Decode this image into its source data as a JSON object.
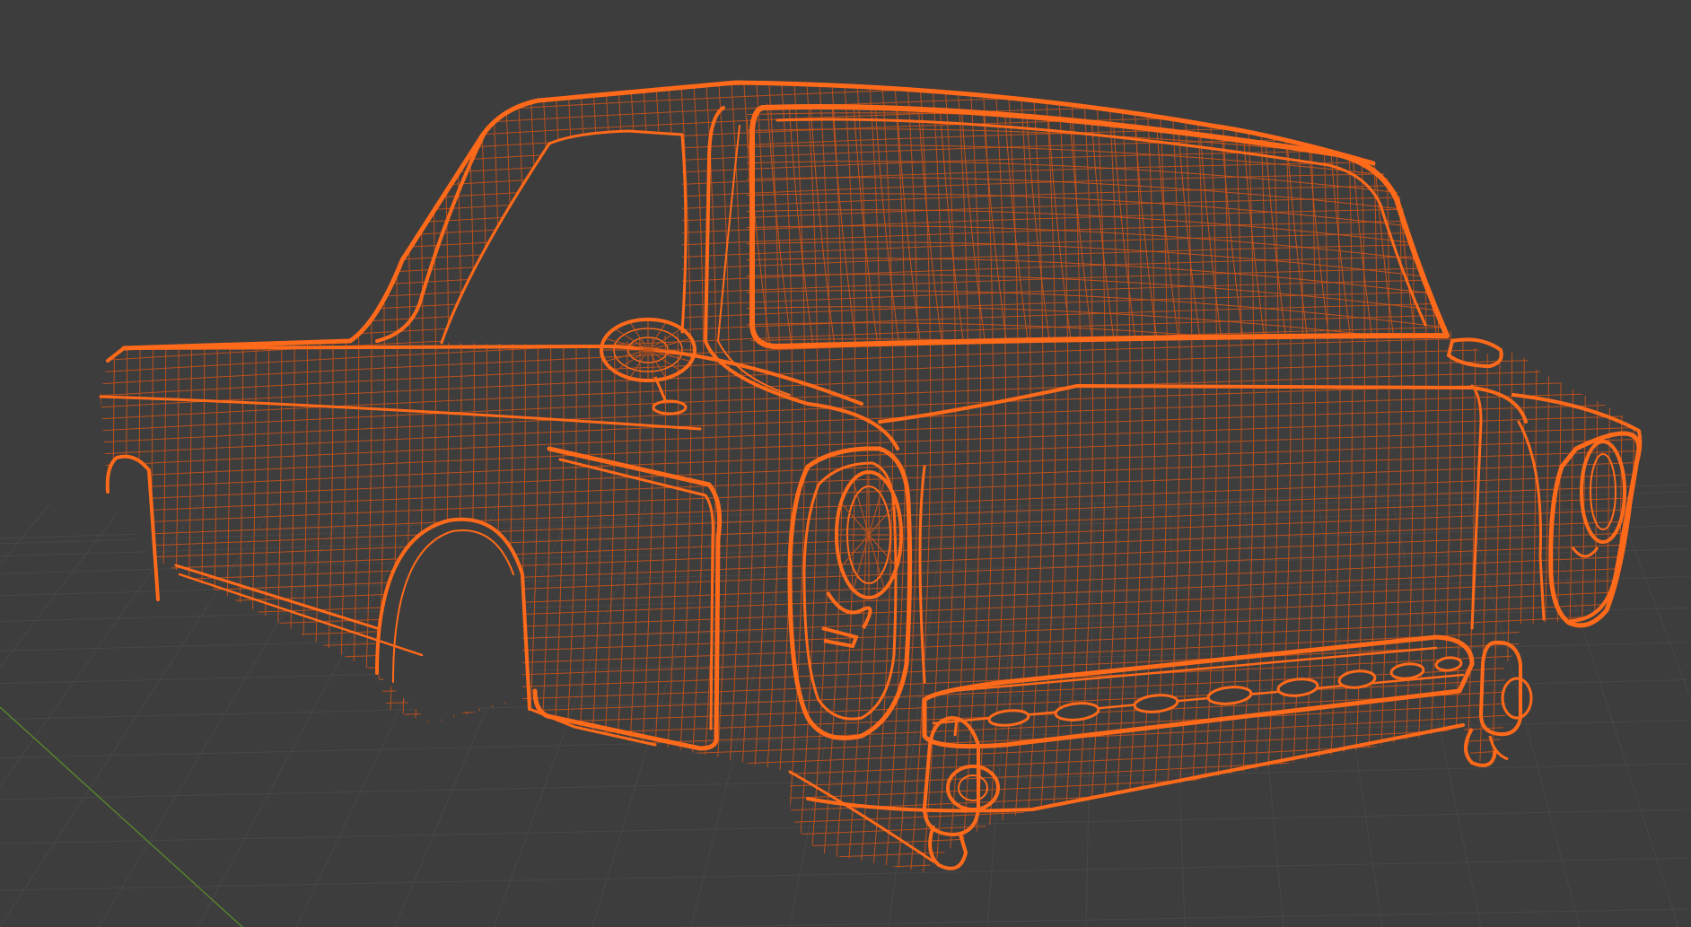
{
  "viewport": {
    "mode": "wireframe",
    "object": "car-body-rear",
    "colors": {
      "background": "#3d3d3d",
      "floor_grid": "#474747",
      "wire": "#ff6a1a",
      "wire_bright": "#ff7a26",
      "wire_dim": "#c8531a",
      "axis_y": "#5a8a2a"
    },
    "icons": [
      "wireframe-mesh"
    ]
  }
}
